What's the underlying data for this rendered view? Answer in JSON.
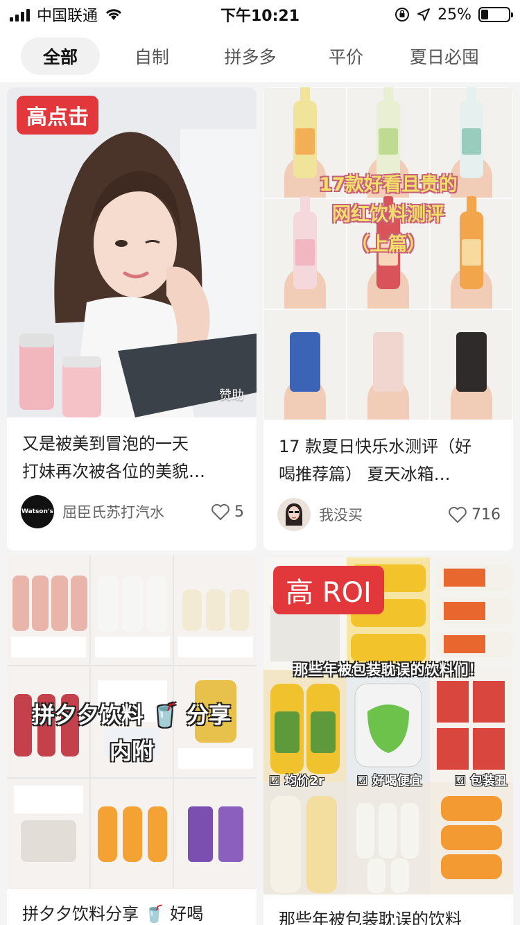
{
  "status_bar": {
    "carrier": "中国联通",
    "time": "下午10:21",
    "battery": "25%",
    "battery_level": 0.25
  },
  "tabs": [
    {
      "label": "全部",
      "active": true
    },
    {
      "label": "自制",
      "active": false
    },
    {
      "label": "拼多多",
      "active": false
    },
    {
      "label": "平价",
      "active": false
    },
    {
      "label": "夏日必囤",
      "active": false
    }
  ],
  "cards": [
    {
      "badge": "高点击",
      "sponsor": "赞助",
      "title_line1": "又是被美到冒泡的一天",
      "title_line2": "打妹再次被各位的美貌…",
      "avatar_text": "Watson's",
      "author": "屈臣氏苏打汽水",
      "likes": "5"
    },
    {
      "overlay_line1": "17款好看且贵的",
      "overlay_line2": "网红饮料测评",
      "overlay_line3": "（上篇）",
      "title_line1": "17 款夏日快乐水测评（好",
      "title_line2": "喝推荐篇） 夏天冰箱…",
      "author": "我没买",
      "likes": "716"
    },
    {
      "overlay_line1": "拼夕夕饮料 🥤 分享",
      "overlay_line2": "内附",
      "title_line1": "拼夕夕饮料分享 🥤 好喝"
    },
    {
      "badge": "高 ROI",
      "overlay_top": "那些年被包装耽误的饮料们！",
      "tag1": "☑ 均价2r",
      "tag2": "☑ 好喝便宜",
      "tag3": "☑ 包装丑",
      "title_line1": "那些年被包装耽误的饮料"
    }
  ],
  "colors": {
    "accent_red": "#e2373b",
    "background": "#f4f4f4"
  }
}
